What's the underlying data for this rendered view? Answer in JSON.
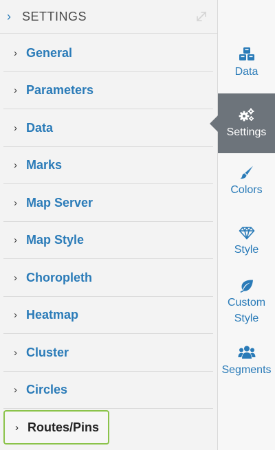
{
  "header": {
    "title": "SETTINGS",
    "chevron_icon": "chevron-right-icon",
    "expand_icon": "expand-diagonal-icon"
  },
  "sections": [
    {
      "label": "General"
    },
    {
      "label": "Parameters"
    },
    {
      "label": "Data"
    },
    {
      "label": "Marks"
    },
    {
      "label": "Map Server"
    },
    {
      "label": "Map Style"
    },
    {
      "label": "Choropleth"
    },
    {
      "label": "Heatmap"
    },
    {
      "label": "Cluster"
    },
    {
      "label": "Circles"
    },
    {
      "label": "Routes/Pins",
      "highlighted": true
    }
  ],
  "tabs": [
    {
      "label": "Data",
      "icon": "cubes-icon",
      "active": false
    },
    {
      "label": "Settings",
      "icon": "gears-icon",
      "active": true
    },
    {
      "label": "Colors",
      "icon": "paintbrush-icon",
      "active": false
    },
    {
      "label": "Style",
      "icon": "diamond-icon",
      "active": false
    },
    {
      "label": "Custom Style",
      "icon": "leaf-icon",
      "active": false
    },
    {
      "label": "Segments",
      "icon": "users-icon",
      "active": false
    }
  ],
  "colors": {
    "accent_blue": "#2a7bb8",
    "active_tab_bg": "#6d747b",
    "highlight_border": "#8bc34a"
  }
}
